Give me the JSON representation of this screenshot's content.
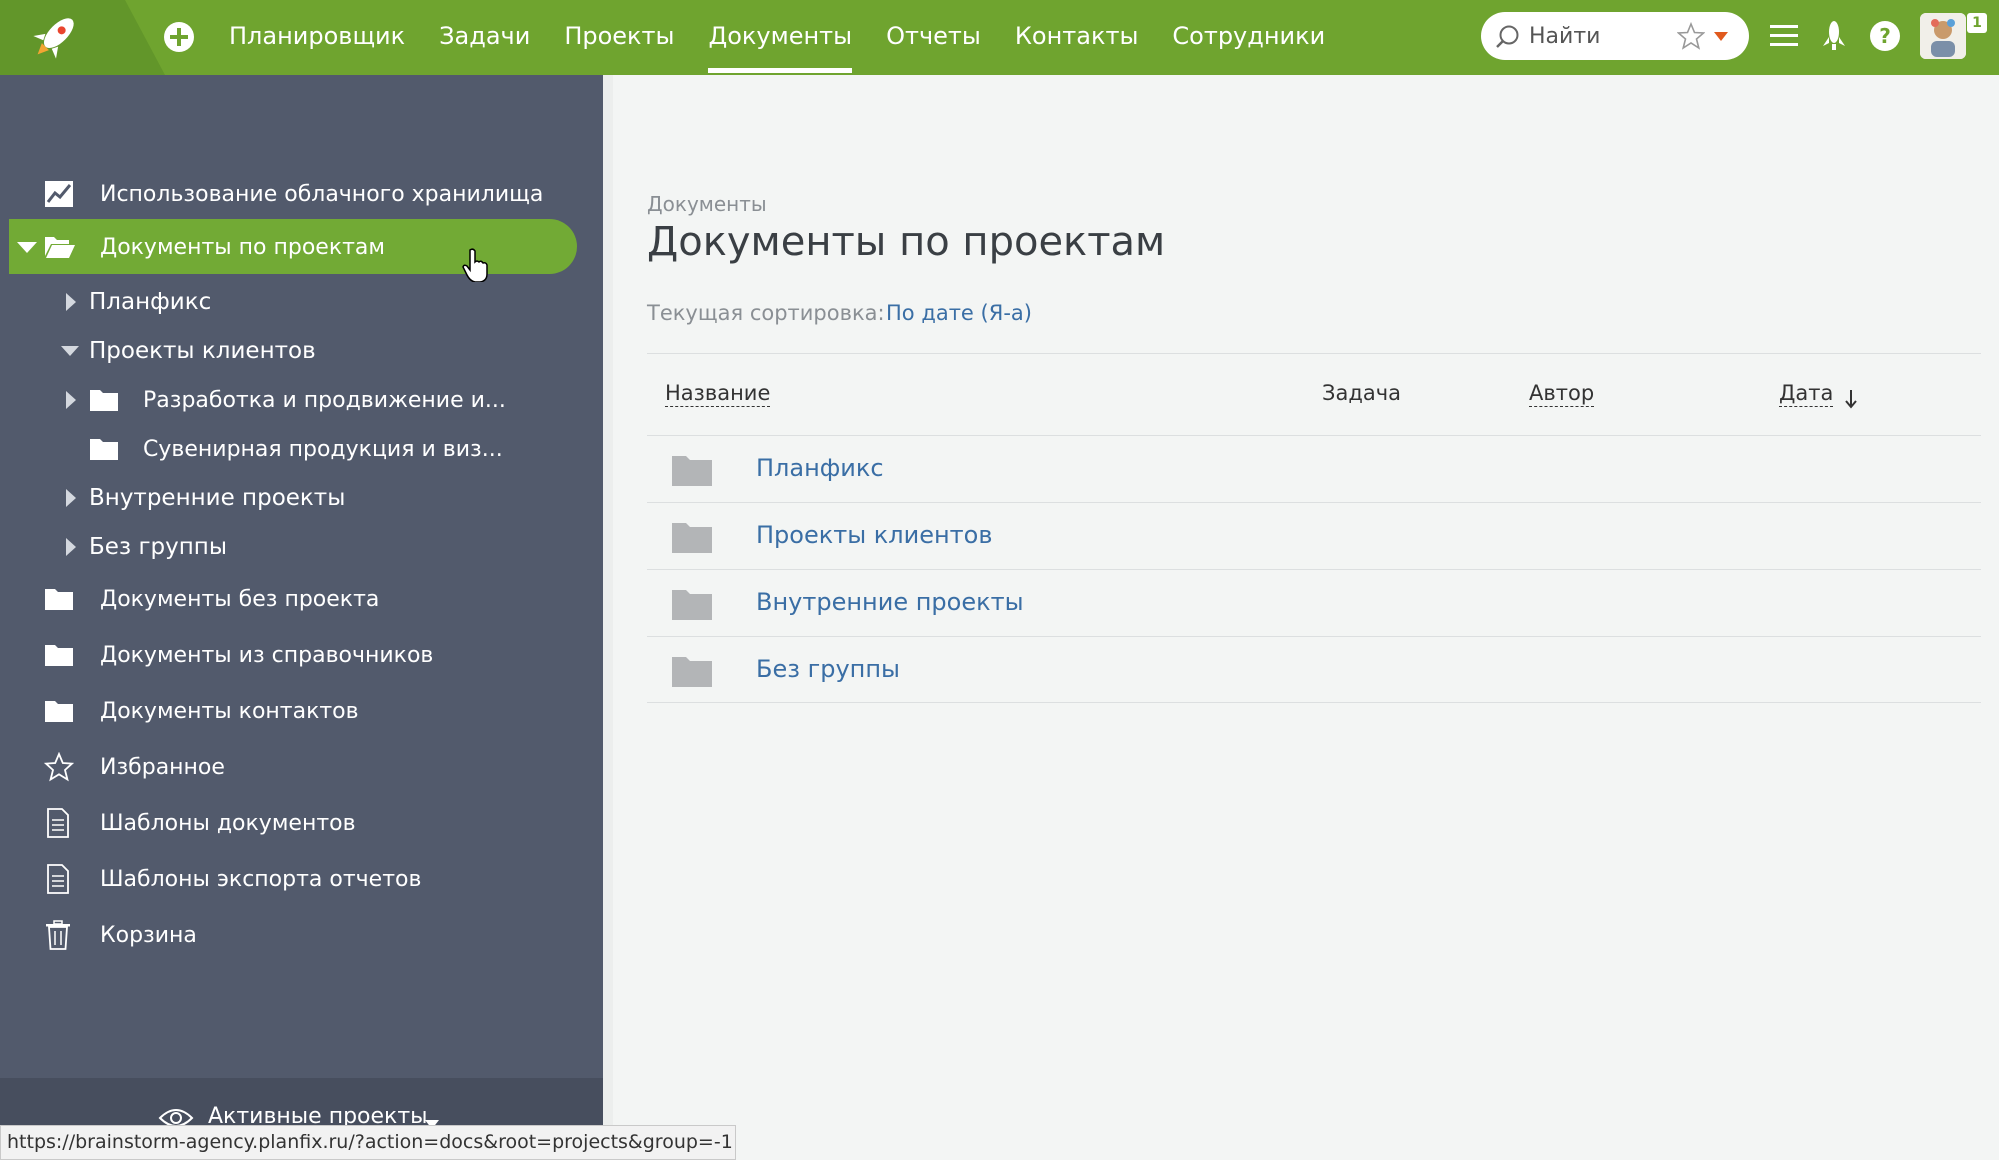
{
  "header": {
    "nav": [
      {
        "label": "Планировщик",
        "active": false
      },
      {
        "label": "Задачи",
        "active": false
      },
      {
        "label": "Проекты",
        "active": false
      },
      {
        "label": "Документы",
        "active": true
      },
      {
        "label": "Отчеты",
        "active": false
      },
      {
        "label": "Контакты",
        "active": false
      },
      {
        "label": "Сотрудники",
        "active": false
      }
    ],
    "search_placeholder": "Найти",
    "notification_badge": "1",
    "icons": [
      "rocket-logo-icon",
      "plus-circle-icon",
      "search-icon",
      "star-icon",
      "menu-icon",
      "rocket-icon",
      "help-icon",
      "avatar"
    ],
    "colors": {
      "brand_green": "#6fa42f",
      "sidebar": "#525a6c",
      "active_item": "#72aa35",
      "link": "#3a6ea5"
    }
  },
  "sidebar": {
    "items": [
      {
        "label": "Использование облачного хранилища",
        "icon": "chart-line-icon"
      },
      {
        "label": "Документы по проектам",
        "icon": "folder-open-icon",
        "active": true
      },
      {
        "label": "Планфикс"
      },
      {
        "label": "Проекты клиентов"
      },
      {
        "label": "Разработка и продвижение и..."
      },
      {
        "label": "Сувенирная продукция и виз..."
      },
      {
        "label": "Внутренние проекты"
      },
      {
        "label": "Без группы"
      },
      {
        "label": "Документы без проекта",
        "icon": "folder-icon"
      },
      {
        "label": "Документы из справочников",
        "icon": "folder-icon"
      },
      {
        "label": "Документы контактов",
        "icon": "folder-icon"
      },
      {
        "label": "Избранное",
        "icon": "star-icon"
      },
      {
        "label": "Шаблоны документов",
        "icon": "document-icon"
      },
      {
        "label": "Шаблоны экспорта отчетов",
        "icon": "document-icon"
      },
      {
        "label": "Корзина",
        "icon": "trash-icon"
      }
    ],
    "bottom_label": "Активные проекты"
  },
  "main": {
    "breadcrumb": "Документы",
    "title": "Документы по проектам",
    "sort_label": "Текущая сортировка:",
    "sort_value": "По дате (Я-а)",
    "columns": {
      "name": "Название",
      "task": "Задача",
      "author": "Автор",
      "date": "Дата"
    },
    "rows": [
      {
        "name": "Планфикс"
      },
      {
        "name": "Проекты клиентов"
      },
      {
        "name": "Внутренние проекты"
      },
      {
        "name": "Без группы"
      }
    ]
  },
  "statusbar": {
    "url": "https://brainstorm-agency.planfix.ru/?action=docs&root=projects&group=-1"
  }
}
